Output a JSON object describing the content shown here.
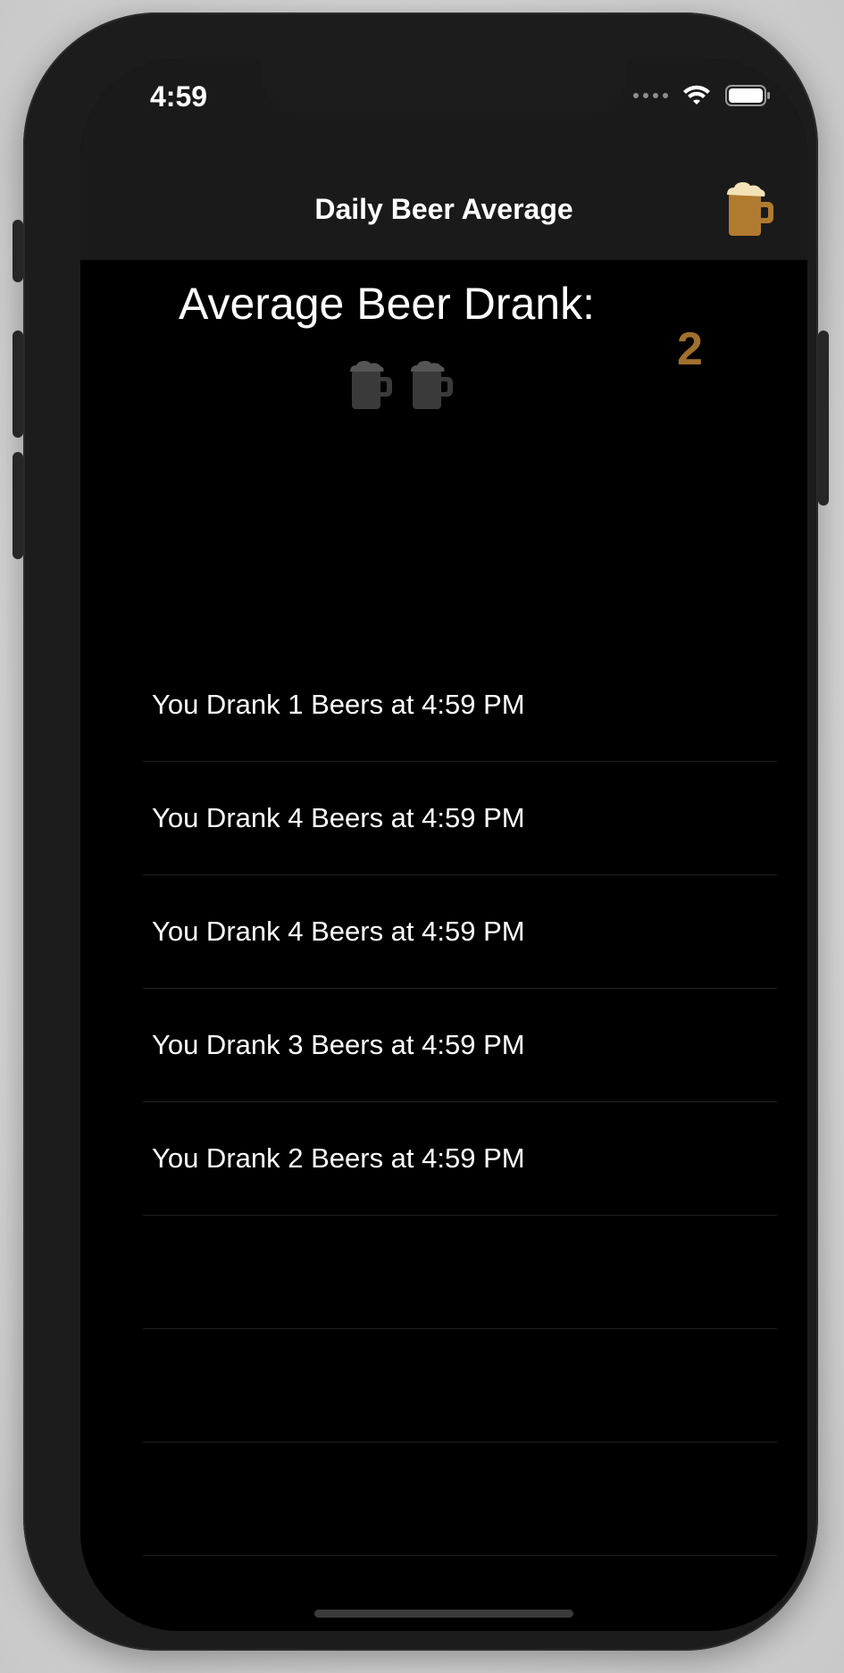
{
  "status_bar": {
    "time": "4:59"
  },
  "nav": {
    "title": "Daily Beer Average",
    "action_icon": "beer-mug-icon"
  },
  "summary": {
    "title": "Average Beer Drank:",
    "value": "2",
    "mug_count": 2
  },
  "entries": [
    {
      "label": "You Drank 1 Beers at 4:59 PM"
    },
    {
      "label": "You Drank 4 Beers at 4:59 PM"
    },
    {
      "label": "You Drank 4 Beers at 4:59 PM"
    },
    {
      "label": "You Drank 3 Beers at 4:59 PM"
    },
    {
      "label": "You Drank 2 Beers at 4:59 PM"
    },
    {
      "label": ""
    },
    {
      "label": ""
    },
    {
      "label": ""
    }
  ],
  "colors": {
    "accent": "#b07a30",
    "mug_gray": "#3a3a3a",
    "background": "#000000",
    "bar": "#1a1a1a"
  }
}
